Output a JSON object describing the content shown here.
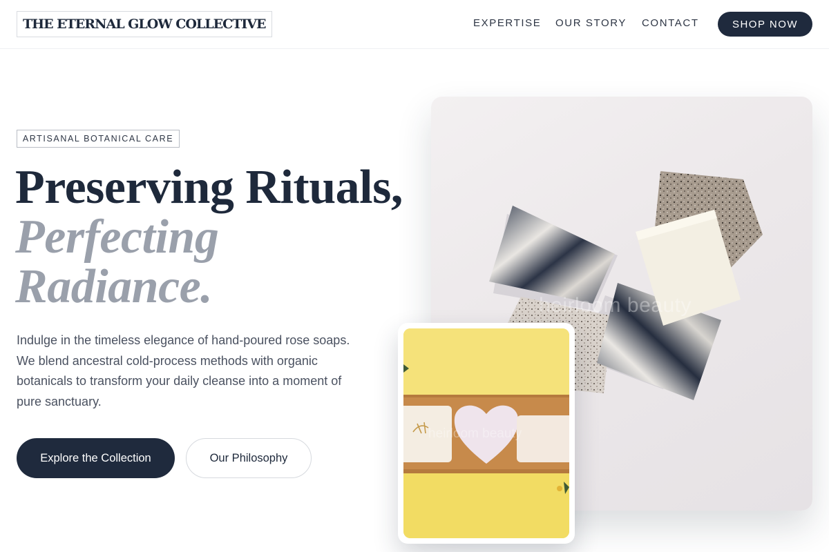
{
  "brand": {
    "logo_text": "THE ETERNAL GLOW COLLECTIVE"
  },
  "nav": {
    "links": [
      {
        "label": "EXPERTISE"
      },
      {
        "label": "OUR STORY"
      },
      {
        "label": "CONTACT"
      }
    ],
    "cta_label": "SHOP NOW"
  },
  "hero": {
    "eyebrow": "ARTISANAL BOTANICAL CARE",
    "headline_line1": "Preserving Rituals,",
    "headline_line2": "Perfecting",
    "headline_line3": "Radiance.",
    "description": "Indulge in the timeless elegance of hand-poured rose soaps. We blend ancestral cold-process methods with organic botanicals to transform your daily cleanse into a moment of pure sanctuary.",
    "primary_button": "Explore the Collection",
    "secondary_button": "Our Philosophy"
  },
  "images": {
    "main_watermark": "heirloom beauty",
    "inset_watermark": "heirloom beauty"
  },
  "colors": {
    "navy": "#1f2a3d",
    "muted_headline": "#9aa0ab",
    "inset_background": "#f2dc63"
  }
}
